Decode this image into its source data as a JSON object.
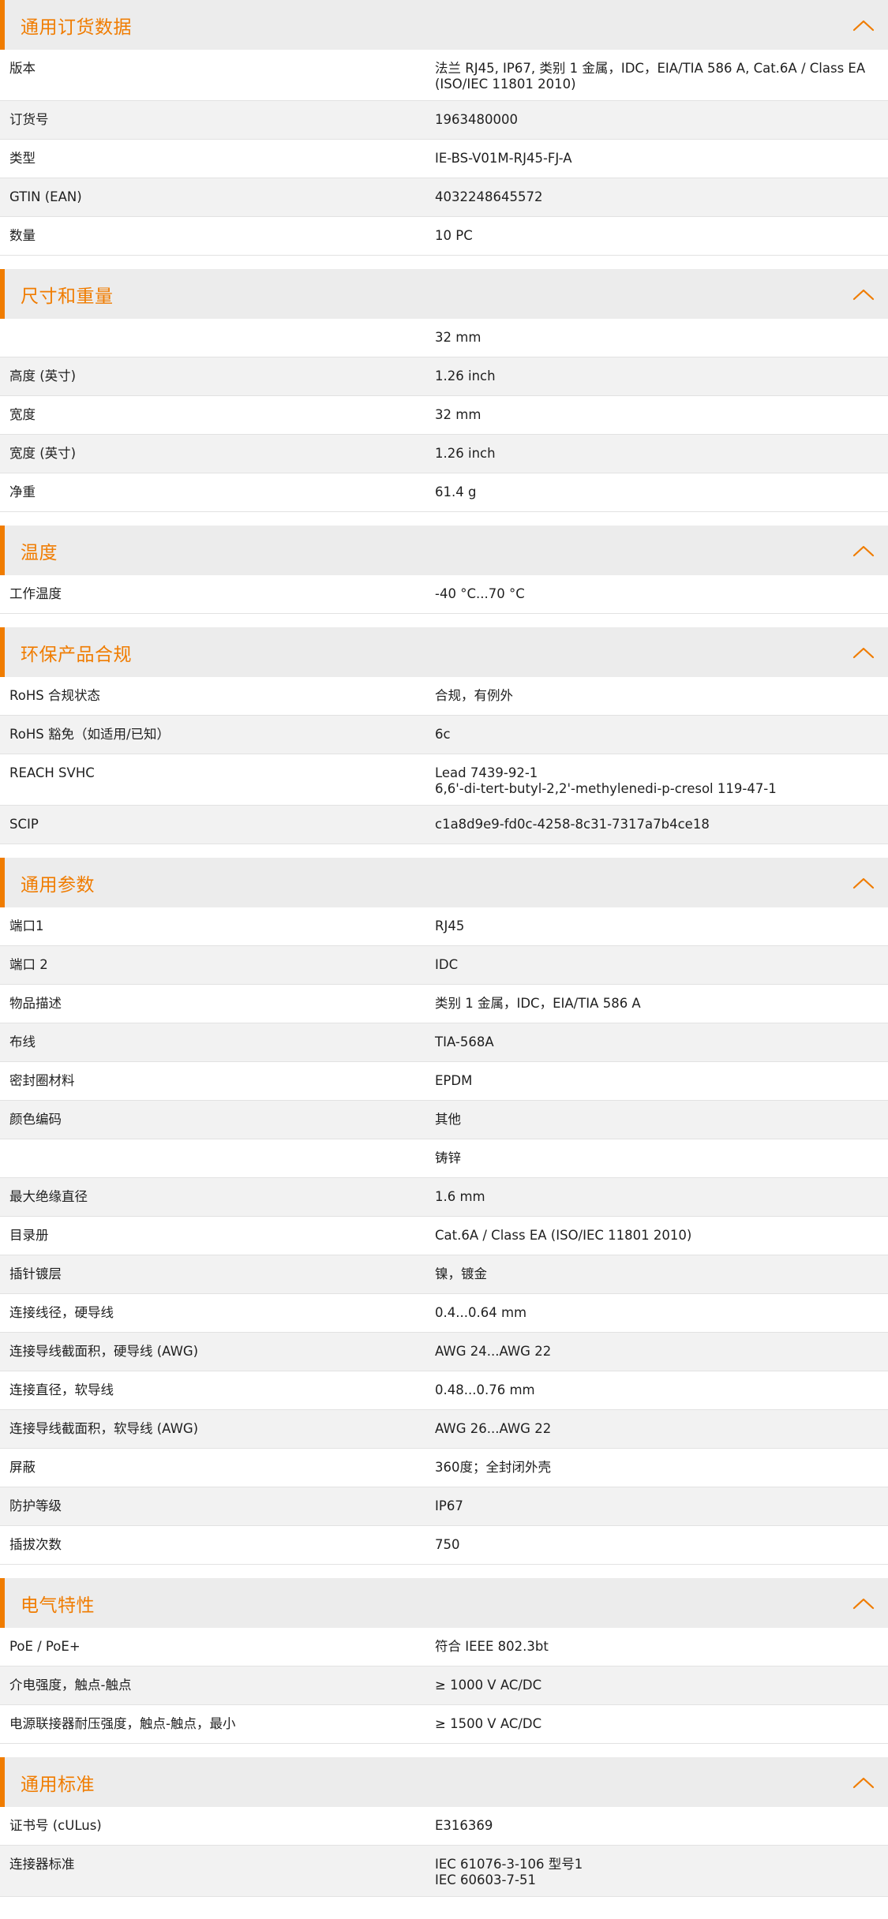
{
  "accent_color": "#f07c00",
  "header_background": "#ececec",
  "collapse_icon": "chevron-up-icon",
  "sections": [
    {
      "title": "通用订货数据",
      "rows": [
        {
          "label": "版本",
          "value": "法兰 RJ45, IP67, 类别 1 金属，IDC，EIA/TIA 586 A, Cat.6A / Class EA\n(ISO/IEC 11801 2010)"
        },
        {
          "label": "订货号",
          "value": "1963480000"
        },
        {
          "label": "类型",
          "value": "IE-BS-V01M-RJ45-FJ-A"
        },
        {
          "label": "GTIN (EAN)",
          "value": "4032248645572"
        },
        {
          "label": "数量",
          "value": "10  PC"
        }
      ]
    },
    {
      "title": "尺寸和重量",
      "rows": [
        {
          "label": "",
          "value": "32  mm"
        },
        {
          "label": "高度 (英寸)",
          "value": "1.26  inch"
        },
        {
          "label": "宽度",
          "value": "32  mm"
        },
        {
          "label": "宽度 (英寸)",
          "value": "1.26  inch"
        },
        {
          "label": "净重",
          "value": "61.4  g"
        }
      ]
    },
    {
      "title": "温度",
      "rows": [
        {
          "label": "工作温度",
          "value": "-40 °C...70 °C"
        }
      ]
    },
    {
      "title": "环保产品合规",
      "rows": [
        {
          "label": "RoHS 合规状态",
          "value": "合规，有例外"
        },
        {
          "label": "RoHS 豁免（如适用/已知）",
          "value": "6c"
        },
        {
          "label": "REACH SVHC",
          "value": "Lead 7439-92-1\n6,6'-di-tert-butyl-2,2'-methylenedi-p-cresol 119-47-1"
        },
        {
          "label": "SCIP",
          "value": "c1a8d9e9-fd0c-4258-8c31-7317a7b4ce18"
        }
      ]
    },
    {
      "title": "通用参数",
      "rows": [
        {
          "label": "端口1",
          "value": "RJ45"
        },
        {
          "label": "端口 2",
          "value": "IDC"
        },
        {
          "label": "物品描述",
          "value": "类别 1 金属，IDC，EIA/TIA 586 A"
        },
        {
          "label": "布线",
          "value": "TIA-568A"
        },
        {
          "label": "密封圈材料",
          "value": "EPDM"
        },
        {
          "label": "颜色编码",
          "value": "其他"
        },
        {
          "label": "",
          "value": "铸锌"
        },
        {
          "label": "最大绝缘直径",
          "value": "1.6  mm"
        },
        {
          "label": "目录册",
          "value": "Cat.6A / Class EA (ISO/IEC 11801 2010)"
        },
        {
          "label": "插针镀层",
          "value": "镍，镀金"
        },
        {
          "label": "连接线径，硬导线",
          "value": "0.4...0.64 mm"
        },
        {
          "label": "连接导线截面积，硬导线 (AWG)",
          "value": "AWG 24...AWG 22"
        },
        {
          "label": "连接直径，软导线",
          "value": "0.48...0.76 mm"
        },
        {
          "label": "连接导线截面积，软导线 (AWG)",
          "value": "AWG 26...AWG 22"
        },
        {
          "label": "屏蔽",
          "value": "360度；全封闭外壳"
        },
        {
          "label": "防护等级",
          "value": "IP67"
        },
        {
          "label": "插拔次数",
          "value": "750"
        }
      ]
    },
    {
      "title": "电气特性",
      "rows": [
        {
          "label": "PoE / PoE+",
          "value": "符合 IEEE 802.3bt"
        },
        {
          "label": "介电强度，触点-触点",
          "value": "≥ 1000 V AC/DC"
        },
        {
          "label": "电源联接器耐压强度，触点-触点，最小",
          "value": "≥ 1500 V AC/DC"
        }
      ]
    },
    {
      "title": "通用标准",
      "rows": [
        {
          "label": "证书号 (cULus)",
          "value": "E316369"
        },
        {
          "label": "连接器标准",
          "value": "IEC 61076-3-106 型号1\nIEC 60603-7-51"
        }
      ]
    }
  ]
}
